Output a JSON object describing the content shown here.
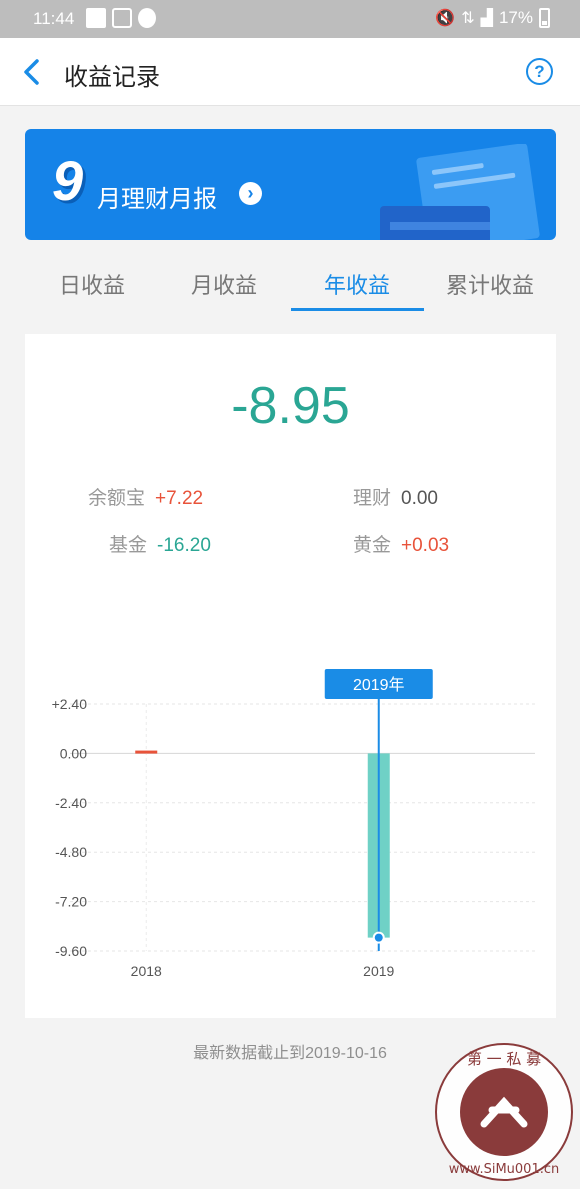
{
  "status_bar": {
    "time": "11:44",
    "battery": "17%"
  },
  "nav": {
    "title": "收益记录",
    "help": "?"
  },
  "banner": {
    "month": "9",
    "text": "月理财月报"
  },
  "tabs": [
    "日收益",
    "月收益",
    "年收益",
    "累计收益"
  ],
  "active_tab": 2,
  "summary": {
    "total": "-8.95",
    "items": [
      {
        "label": "余额宝",
        "value": "+7.22"
      },
      {
        "label": "理财",
        "value": "0.00"
      },
      {
        "label": "基金",
        "value": "-16.20"
      },
      {
        "label": "黄金",
        "value": "+0.03"
      }
    ]
  },
  "chart_data": {
    "type": "bar",
    "categories": [
      "2018",
      "2019"
    ],
    "values": [
      0.04,
      -8.95
    ],
    "yticks": [
      "+2.40",
      "0.00",
      "-2.40",
      "-4.80",
      "-7.20",
      "-9.60"
    ],
    "ylim": [
      -9.6,
      2.4
    ],
    "tooltip": "2019年",
    "colors": {
      "positive": "#e8533a",
      "negative": "#6fd1c6",
      "indicator": "#1a8ce6"
    }
  },
  "footer": {
    "text": "最新数据截止到2019-10-16"
  },
  "watermark": {
    "top_text": "第 一 私 募",
    "bottom_text": "www.SiMu001.cn"
  }
}
